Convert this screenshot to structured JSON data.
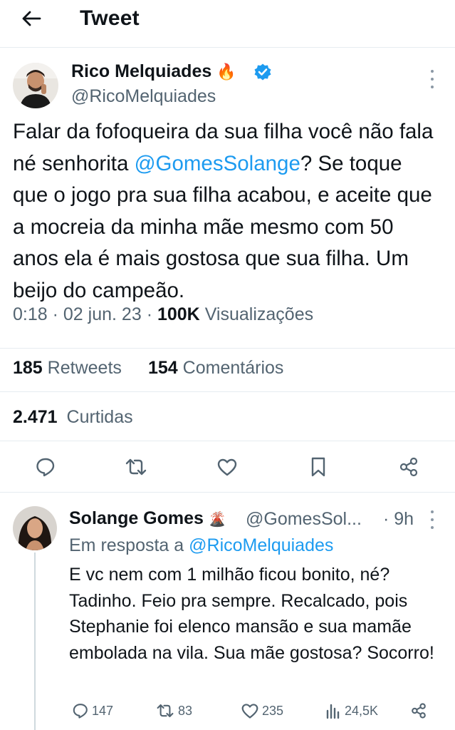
{
  "header": {
    "title": "Tweet"
  },
  "tweet": {
    "author_name": "Rico Melquiades",
    "author_emoji": "🔥",
    "author_handle": "@RicoMelquiades",
    "text_1": "Falar da fofoqueira da sua filha você não fala né senhorita ",
    "mention": "@GomesSolange",
    "text_2": "? Se toque que o jogo pra sua filha acabou, e aceite que a mocreia da minha mãe mesmo com 50 anos ela é mais gostosa que sua filha. Um beijo do campeão.",
    "time": "0:18",
    "date": "02 jun. 23",
    "views_count": "100K",
    "views_label": "Visualizações",
    "retweets_count": "185",
    "retweets_label": "Retweets",
    "comments_count": "154",
    "comments_label": "Comentários",
    "likes_count": "2.471",
    "likes_label": "Curtidas"
  },
  "reply": {
    "author_name": "Solange Gomes",
    "author_emoji": "🌋",
    "author_handle": "@GomesSol...",
    "time": "· 9h",
    "replying_label": "Em resposta a",
    "replying_to": "@RicoMelquiades",
    "text": "E vc nem com 1 milhão ficou bonito, né? Tadinho. Feio pra sempre. Recalcado, pois Stephanie foi elenco mansão e sua mamãe embolada na vila. Sua mãe gostosa? Socorro!",
    "reply_count": "147",
    "retweet_count": "83",
    "like_count": "235",
    "view_count": "24,5K"
  },
  "colors": {
    "accent": "#1d9bf0",
    "text": "#0f1419",
    "secondary": "#536471",
    "divider": "#e6ecf0"
  },
  "icons": [
    "back-arrow-icon",
    "verified-badge-icon",
    "more-options-icon",
    "reply-icon",
    "retweet-icon",
    "like-icon",
    "bookmark-icon",
    "share-icon",
    "views-icon"
  ]
}
